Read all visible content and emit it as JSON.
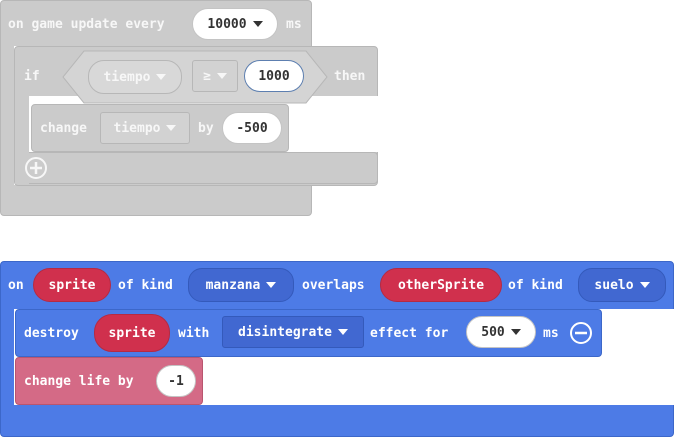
{
  "colors": {
    "disabled_block": "#cbcbcb",
    "events_block": "#4d7be6",
    "sprite_variable": "#d0304d",
    "info_block": "#d46a86"
  },
  "game_update": {
    "on_label": "on game update every",
    "interval_value": "10000",
    "unit_label": "ms",
    "if_label": "if",
    "cond_variable": "tiempo",
    "cond_operator": "≥",
    "cond_value": "1000",
    "then_label": "then",
    "change_label": "change",
    "change_variable": "tiempo",
    "by_label": "by",
    "change_value": "-500",
    "add_icon": "plus-circle-icon"
  },
  "overlap": {
    "on_label": "on",
    "sprite_label": "sprite",
    "kind_label_1": "of kind",
    "kind_1": "manzana",
    "overlaps_label": "overlaps",
    "other_sprite_label": "otherSprite",
    "kind_label_2": "of kind",
    "kind_2": "suelo",
    "destroy_label": "destroy",
    "destroy_target": "sprite",
    "with_label": "with",
    "effect_name": "disintegrate",
    "effect_label": "effect for",
    "effect_duration": "500",
    "effect_unit": "ms",
    "remove_icon": "minus-circle-icon",
    "change_life_label": "change life by",
    "change_life_value": "-1"
  }
}
